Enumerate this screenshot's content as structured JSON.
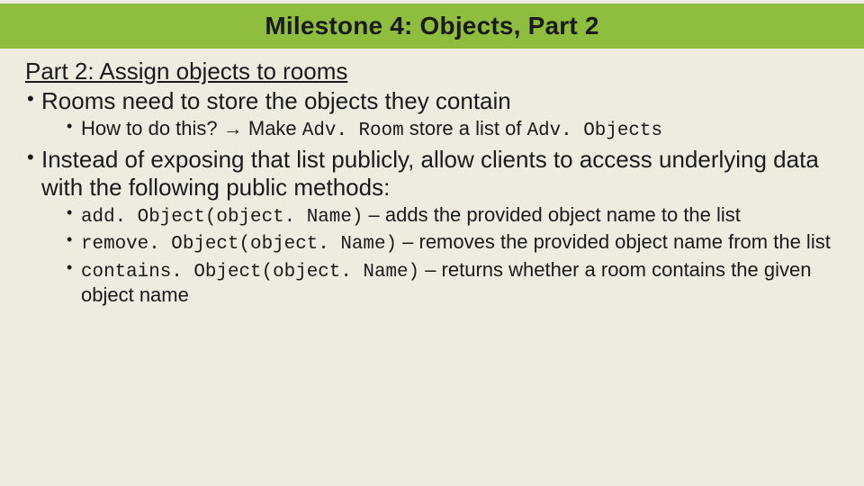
{
  "title": "Milestone 4: Objects, Part 2",
  "subtitle": "Part 2: Assign objects to rooms",
  "b1": {
    "text": "Rooms need to store the objects they contain",
    "sub": {
      "pre": "How to do this? → Make ",
      "code1": "Adv. Room",
      "mid": " store a list of ",
      "code2": "Adv. Objects"
    }
  },
  "b2": {
    "text": "Instead of exposing that list publicly, allow clients to access underlying data with the following public methods:",
    "m1": {
      "code": "add. Object(object. Name)",
      "desc": " – adds the provided object name to the list"
    },
    "m2": {
      "code": "remove. Object(object. Name)",
      "desc": " – removes the provided object name from the list"
    },
    "m3": {
      "code": "contains. Object(object. Name)",
      "desc": " – returns whether a room contains the given object name"
    }
  }
}
